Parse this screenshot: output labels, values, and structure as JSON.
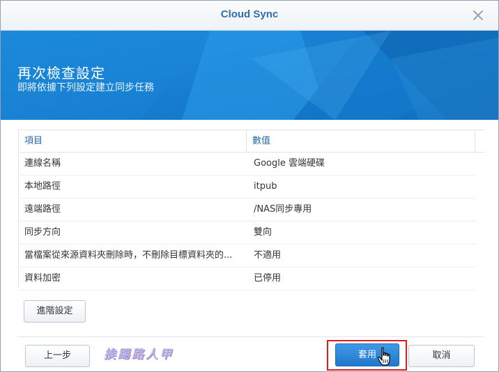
{
  "window": {
    "title": "Cloud Sync",
    "close_icon": "close-icon"
  },
  "banner": {
    "title": "再次檢查設定",
    "subtitle": "即將依據下列設定建立同步任務",
    "color": "#1d88d8"
  },
  "table": {
    "headers": [
      "項目",
      "數值"
    ],
    "rows": [
      {
        "item": "連線名稱",
        "value": "Google 雲端硬碟"
      },
      {
        "item": "本地路徑",
        "value": "itpub"
      },
      {
        "item": "遠端路徑",
        "value": "/NAS同步專用"
      },
      {
        "item": "同步方向",
        "value": "雙向"
      },
      {
        "item": "當檔案從來源資料夾刪除時，不刪除目標資料夾的...",
        "value": "不適用"
      },
      {
        "item": "資料加密",
        "value": "已停用"
      }
    ]
  },
  "buttons": {
    "advanced": "進階設定",
    "back": "上一步",
    "apply": "套用",
    "cancel": "取消"
  },
  "watermark": "挨踢路人甲",
  "colors": {
    "accent": "#2f6ea8",
    "primary_button": "#2177cc",
    "highlight": "#e01c1c"
  }
}
